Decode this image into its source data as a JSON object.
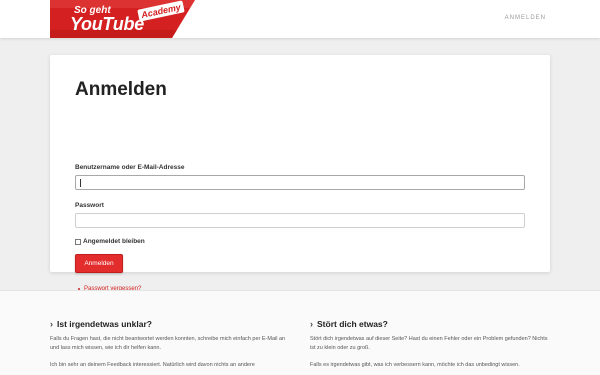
{
  "header": {
    "logo": {
      "line1": "So geht",
      "line2": "YouTube",
      "badge": "Academy"
    },
    "nav_login": "ANMELDEN"
  },
  "form": {
    "title": "Anmelden",
    "username_label": "Benutzername oder E-Mail-Adresse",
    "username_value": "",
    "password_label": "Passwort",
    "password_value": "",
    "remember_label": "Angemeldet bleiben",
    "remember_checked": false,
    "submit_label": "Anmelden",
    "forgot_link": "Passwort vergessen?"
  },
  "footer": {
    "col1": {
      "title": "Ist irgendetwas unklar?",
      "p1": "Falls du Fragen hast, die nicht beantwortet werden konnten, schreibe mich einfach per E-Mail an und lass mich wissen, wie ich dir helfen kann.",
      "p2": "Ich bin sehr an deinem Feedback interessiert. Natürlich wird davon nichts an andere"
    },
    "col2": {
      "title": "Stört dich etwas?",
      "p1": "Stört dich irgendetwas auf dieser Seite? Hast du einen Fehler oder ein Problem gefunden? Nichts ist zu klein oder zu groß.",
      "p2": "Falls es irgendetwas gibt, was ich verbessern kann, möchte ich das unbedingt wissen."
    }
  },
  "colors": {
    "accent": "#e32c2c",
    "link": "#d42020",
    "background": "#efefef"
  }
}
